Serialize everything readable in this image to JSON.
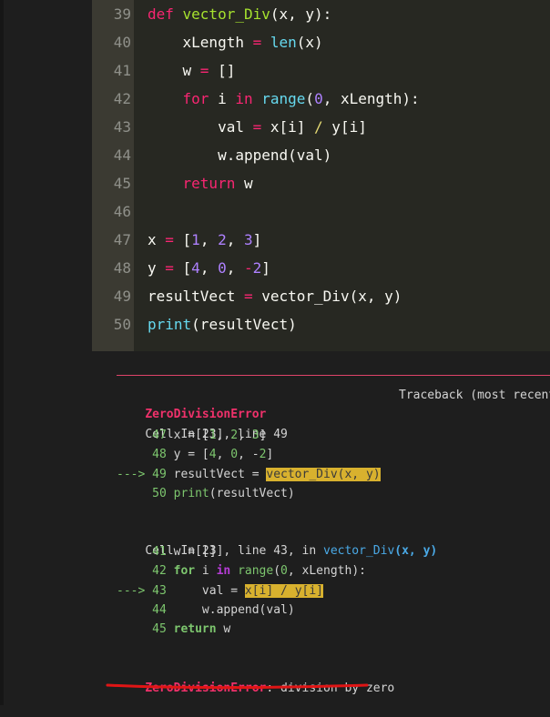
{
  "editor": {
    "lines": [
      {
        "n": "39",
        "tokens": [
          {
            "t": "def ",
            "c": "kw"
          },
          {
            "t": "vector_Div",
            "c": "fn"
          },
          {
            "t": "(x, y):",
            "c": ""
          }
        ]
      },
      {
        "n": "40",
        "tokens": [
          {
            "t": "    xLength ",
            "c": ""
          },
          {
            "t": "=",
            "c": "op"
          },
          {
            "t": " ",
            "c": ""
          },
          {
            "t": "len",
            "c": "bi"
          },
          {
            "t": "(x)",
            "c": ""
          }
        ]
      },
      {
        "n": "41",
        "tokens": [
          {
            "t": "    w ",
            "c": ""
          },
          {
            "t": "=",
            "c": "op"
          },
          {
            "t": " []",
            "c": ""
          }
        ]
      },
      {
        "n": "42",
        "tokens": [
          {
            "t": "    ",
            "c": ""
          },
          {
            "t": "for",
            "c": "kw"
          },
          {
            "t": " i ",
            "c": ""
          },
          {
            "t": "in",
            "c": "kw"
          },
          {
            "t": " ",
            "c": ""
          },
          {
            "t": "range",
            "c": "bi"
          },
          {
            "t": "(",
            "c": ""
          },
          {
            "t": "0",
            "c": "num"
          },
          {
            "t": ", xLength):",
            "c": ""
          }
        ]
      },
      {
        "n": "43",
        "tokens": [
          {
            "t": "        val ",
            "c": ""
          },
          {
            "t": "=",
            "c": "op"
          },
          {
            "t": " x[i] ",
            "c": ""
          },
          {
            "t": "/",
            "c": "sl"
          },
          {
            "t": " y[i]",
            "c": ""
          }
        ]
      },
      {
        "n": "44",
        "tokens": [
          {
            "t": "        w.append(val)",
            "c": ""
          }
        ]
      },
      {
        "n": "45",
        "tokens": [
          {
            "t": "    ",
            "c": ""
          },
          {
            "t": "return",
            "c": "kw"
          },
          {
            "t": " w",
            "c": ""
          }
        ]
      },
      {
        "n": "46",
        "tokens": []
      },
      {
        "n": "47",
        "tokens": [
          {
            "t": "x ",
            "c": ""
          },
          {
            "t": "=",
            "c": "op"
          },
          {
            "t": " [",
            "c": ""
          },
          {
            "t": "1",
            "c": "num"
          },
          {
            "t": ", ",
            "c": ""
          },
          {
            "t": "2",
            "c": "num"
          },
          {
            "t": ", ",
            "c": ""
          },
          {
            "t": "3",
            "c": "num"
          },
          {
            "t": "]",
            "c": ""
          }
        ]
      },
      {
        "n": "48",
        "tokens": [
          {
            "t": "y ",
            "c": ""
          },
          {
            "t": "=",
            "c": "op"
          },
          {
            "t": " [",
            "c": ""
          },
          {
            "t": "4",
            "c": "num"
          },
          {
            "t": ", ",
            "c": ""
          },
          {
            "t": "0",
            "c": "num"
          },
          {
            "t": ", ",
            "c": ""
          },
          {
            "t": "-",
            "c": "op"
          },
          {
            "t": "2",
            "c": "num"
          },
          {
            "t": "]",
            "c": ""
          }
        ]
      },
      {
        "n": "49",
        "tokens": [
          {
            "t": "resultVect ",
            "c": ""
          },
          {
            "t": "=",
            "c": "op"
          },
          {
            "t": " vector_Div(x, y)",
            "c": ""
          }
        ]
      },
      {
        "n": "50",
        "tokens": [
          {
            "t": "print",
            "c": "bi"
          },
          {
            "t": "(resultVect)",
            "c": ""
          }
        ]
      }
    ]
  },
  "traceback": {
    "error_name": "ZeroDivisionError",
    "header_right": "Traceback (most recent call last)",
    "frame1": {
      "cell_label": "Cell In[23], line 49",
      "lines": [
        [
          {
            "t": "     47 ",
            "c": "grn"
          },
          {
            "t": "x ",
            "c": ""
          },
          {
            "t": "=",
            "c": ""
          },
          {
            "t": " [",
            "c": ""
          },
          {
            "t": "1",
            "c": "grn"
          },
          {
            "t": ", ",
            "c": ""
          },
          {
            "t": "2",
            "c": "grn"
          },
          {
            "t": ", ",
            "c": ""
          },
          {
            "t": "3",
            "c": "grn"
          },
          {
            "t": "]",
            "c": ""
          }
        ],
        [
          {
            "t": "     48 ",
            "c": "grn"
          },
          {
            "t": "y ",
            "c": ""
          },
          {
            "t": "=",
            "c": ""
          },
          {
            "t": " [",
            "c": ""
          },
          {
            "t": "4",
            "c": "grn"
          },
          {
            "t": ", ",
            "c": ""
          },
          {
            "t": "0",
            "c": "grn"
          },
          {
            "t": ", ",
            "c": ""
          },
          {
            "t": "-",
            "c": ""
          },
          {
            "t": "2",
            "c": "grn"
          },
          {
            "t": "]",
            "c": ""
          }
        ],
        [
          {
            "t": "---> 49 ",
            "c": "arr"
          },
          {
            "t": "resultVect ",
            "c": ""
          },
          {
            "t": "=",
            "c": ""
          },
          {
            "t": " ",
            "c": ""
          },
          {
            "t": "vector_Div(x, y)",
            "c": "hl"
          }
        ],
        [
          {
            "t": "     50 ",
            "c": "grn"
          },
          {
            "t": "print",
            "c": "grn"
          },
          {
            "t": "(resultVect)",
            "c": ""
          }
        ]
      ]
    },
    "frame2": {
      "cell_label": "Cell In[23], line 43",
      "in_text": ", in ",
      "func_name": "vector_Div",
      "func_args": "(x, y)",
      "lines": [
        [
          {
            "t": "     41 ",
            "c": "grn"
          },
          {
            "t": "w ",
            "c": ""
          },
          {
            "t": "=",
            "c": ""
          },
          {
            "t": " []",
            "c": ""
          }
        ],
        [
          {
            "t": "     42 ",
            "c": "grn"
          },
          {
            "t": "for",
            "c": "kwg"
          },
          {
            "t": " i ",
            "c": ""
          },
          {
            "t": "in",
            "c": "kwp"
          },
          {
            "t": " ",
            "c": ""
          },
          {
            "t": "range",
            "c": "grn"
          },
          {
            "t": "(",
            "c": ""
          },
          {
            "t": "0",
            "c": "grn"
          },
          {
            "t": ", xLength):",
            "c": ""
          }
        ],
        [
          {
            "t": "---> 43 ",
            "c": "arr"
          },
          {
            "t": "    val ",
            "c": ""
          },
          {
            "t": "=",
            "c": ""
          },
          {
            "t": " ",
            "c": ""
          },
          {
            "t": "x[i] / y[i]",
            "c": "hl"
          }
        ],
        [
          {
            "t": "     44 ",
            "c": "grn"
          },
          {
            "t": "    w.append(val)",
            "c": ""
          }
        ],
        [
          {
            "t": "     45 ",
            "c": "grn"
          },
          {
            "t": "return",
            "c": "kwg"
          },
          {
            "t": " w",
            "c": ""
          }
        ]
      ]
    },
    "final_message": ": division by zero"
  }
}
